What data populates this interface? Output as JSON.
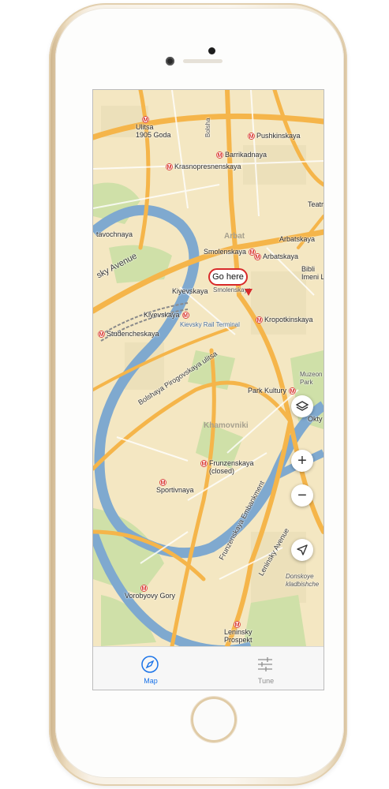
{
  "map": {
    "districts": [
      "Arbat",
      "Khamovniki"
    ],
    "stations": [
      {
        "name": "Ulitsa\n1905 Goda"
      },
      {
        "name": "Barrikadnaya"
      },
      {
        "name": "Krasnopresnenskaya"
      },
      {
        "name": "Pushkinskaya"
      },
      {
        "name": "Smolenskaya"
      },
      {
        "name": "Smolenskaya"
      },
      {
        "name": "Arbatskaya"
      },
      {
        "name": "Arbatskaya"
      },
      {
        "name": "Kiyevskaya"
      },
      {
        "name": "Kiyevskaya"
      },
      {
        "name": "Studencheskaya"
      },
      {
        "name": "Kropotkinskaya"
      },
      {
        "name": "Park Kultury"
      },
      {
        "name": "Frunzenskaya\n(closed)"
      },
      {
        "name": "Sportivnaya"
      },
      {
        "name": "Vorobyovy Gory"
      },
      {
        "name": "Leninsky\nProspekt"
      }
    ],
    "streets": [
      "sky Avenue",
      "Bolshaya Pirogovskaya ulitsa",
      "Frunzenskaya Embankment",
      "Leninsky Avenue",
      "Kievsky Rail Terminal",
      "tavochnaya",
      "Teatr",
      "Bibli\nImeni L",
      "Muzeon\nPark",
      "Okty",
      "Donskoye\nkladbishche",
      "Bolsha"
    ],
    "callout": "Go here"
  },
  "controls": {
    "layers": "layers-icon",
    "zoom_in": "+",
    "zoom_out": "−",
    "locate": "locate-arrow-icon"
  },
  "tabs": [
    {
      "label": "Map",
      "icon": "compass-icon",
      "active": true
    },
    {
      "label": "Tune",
      "icon": "sliders-icon",
      "active": false
    }
  ],
  "colors": {
    "accent": "#1a73e8",
    "road": "#f5b54a",
    "river": "#7fa9cf",
    "park": "#cfe0a8",
    "metro": "#d8332b"
  }
}
